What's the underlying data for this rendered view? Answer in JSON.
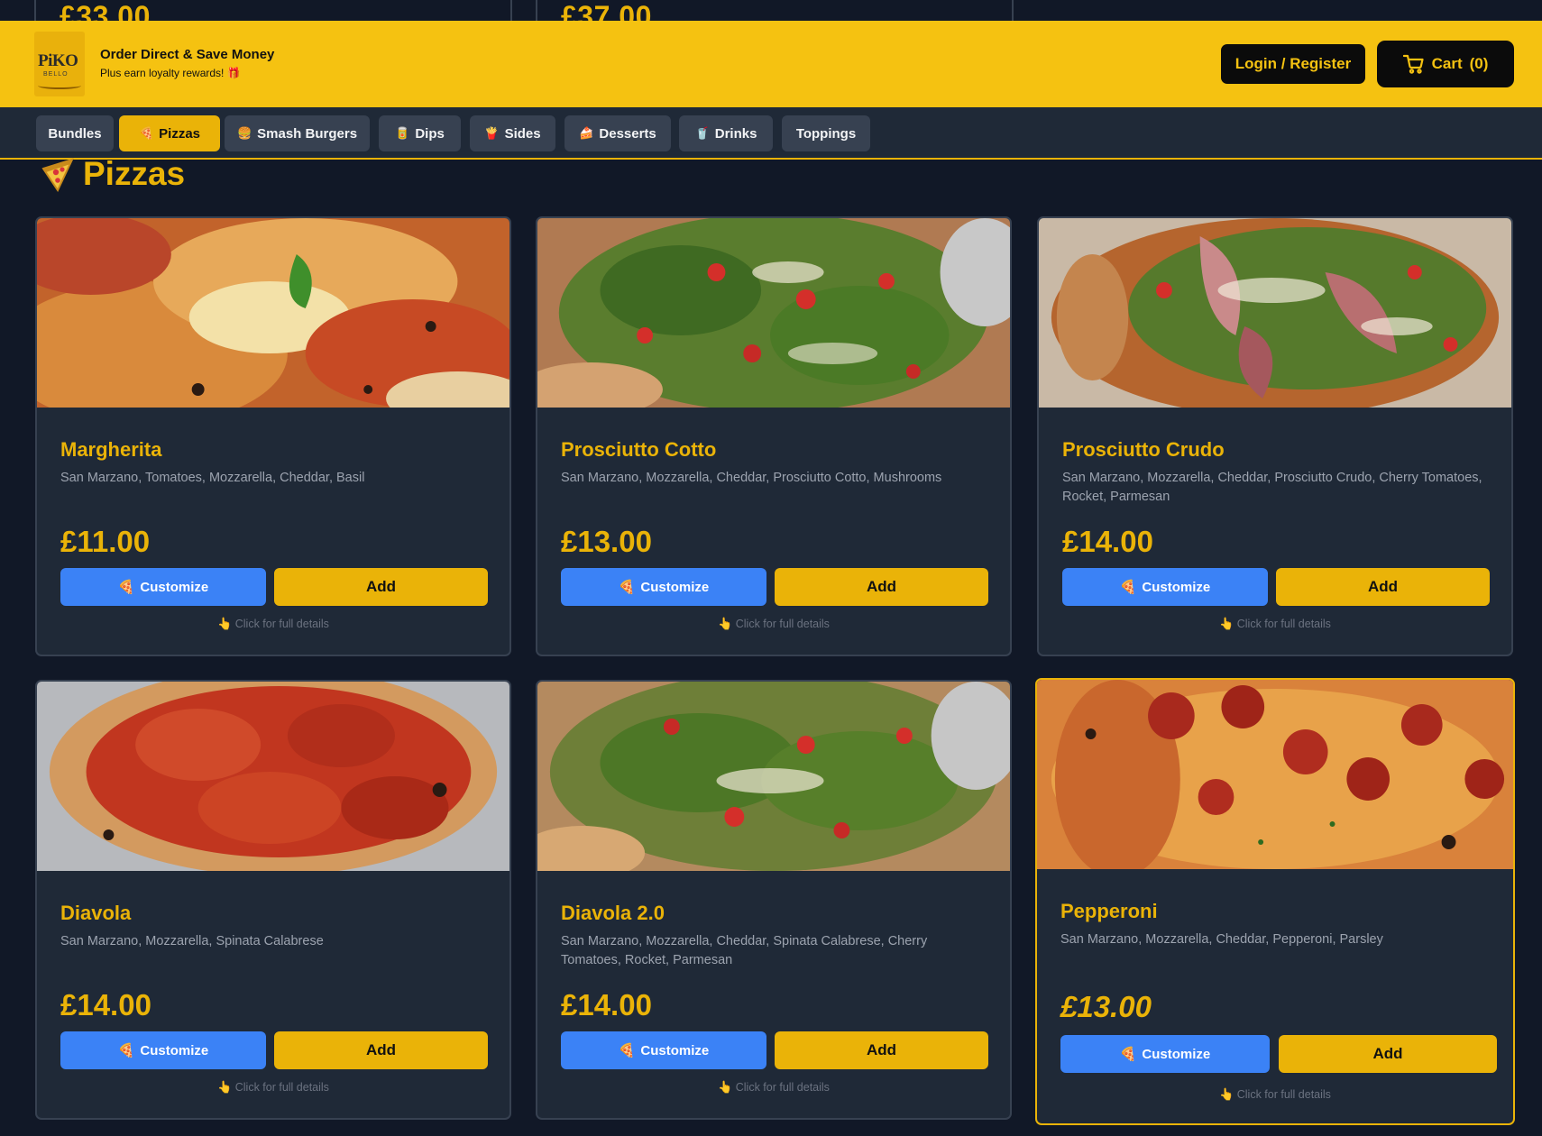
{
  "previous_row": {
    "prices": [
      "£33.00",
      "£37.00"
    ]
  },
  "header": {
    "logo_text": "PiKO",
    "logo_sub": "BELLO",
    "tagline_title": "Order Direct & Save Money",
    "tagline_sub": "Plus earn loyalty rewards!",
    "tagline_emoji": "🎁",
    "login_label": "Login / Register",
    "cart_label": "Cart",
    "cart_count": "(0)",
    "brand_color": "#f5c211"
  },
  "categories": [
    {
      "label": "Bundles",
      "icon": ""
    },
    {
      "label": "Pizzas",
      "icon": "🍕",
      "active": true
    },
    {
      "label": "Smash Burgers",
      "icon": "🍔"
    },
    {
      "label": "Dips",
      "icon": "🥫"
    },
    {
      "label": "Sides",
      "icon": "🍟"
    },
    {
      "label": "Desserts",
      "icon": "🍰"
    },
    {
      "label": "Drinks",
      "icon": "🥤"
    },
    {
      "label": "Toppings",
      "icon": ""
    }
  ],
  "section": {
    "icon": "pizza-slice-icon",
    "title": "Pizzas"
  },
  "products": [
    {
      "name": "Margherita",
      "description": "San Marzano, Tomatoes, Mozzarella, Cheddar, Basil",
      "price": "£11.00",
      "customize_label": "Customize",
      "add_label": "Add",
      "hint": "Click for full details"
    },
    {
      "name": "Prosciutto Cotto",
      "description": "San Marzano, Mozzarella, Cheddar, Prosciutto Cotto, Mushrooms",
      "price": "£13.00",
      "customize_label": "Customize",
      "add_label": "Add",
      "hint": "Click for full details"
    },
    {
      "name": "Prosciutto Crudo",
      "description": "San Marzano, Mozzarella, Cheddar, Prosciutto Crudo, Cherry Tomatoes, Rocket, Parmesan",
      "price": "£14.00",
      "customize_label": "Customize",
      "add_label": "Add",
      "hint": "Click for full details"
    },
    {
      "name": "Diavola",
      "description": "San Marzano, Mozzarella, Spinata Calabrese",
      "price": "£14.00",
      "customize_label": "Customize",
      "add_label": "Add",
      "hint": "Click for full details"
    },
    {
      "name": "Diavola 2.0",
      "description": "San Marzano, Mozzarella, Cheddar, Spinata Calabrese, Cherry Tomatoes, Rocket, Parmesan",
      "price": "£14.00",
      "customize_label": "Customize",
      "add_label": "Add",
      "hint": "Click for full details"
    },
    {
      "name": "Pepperoni",
      "description": "San Marzano, Mozzarella, Cheddar, Pepperoni, Parsley",
      "price": "£13.00",
      "customize_label": "Customize",
      "add_label": "Add",
      "hint": "Click for full details",
      "highlighted": true
    }
  ]
}
